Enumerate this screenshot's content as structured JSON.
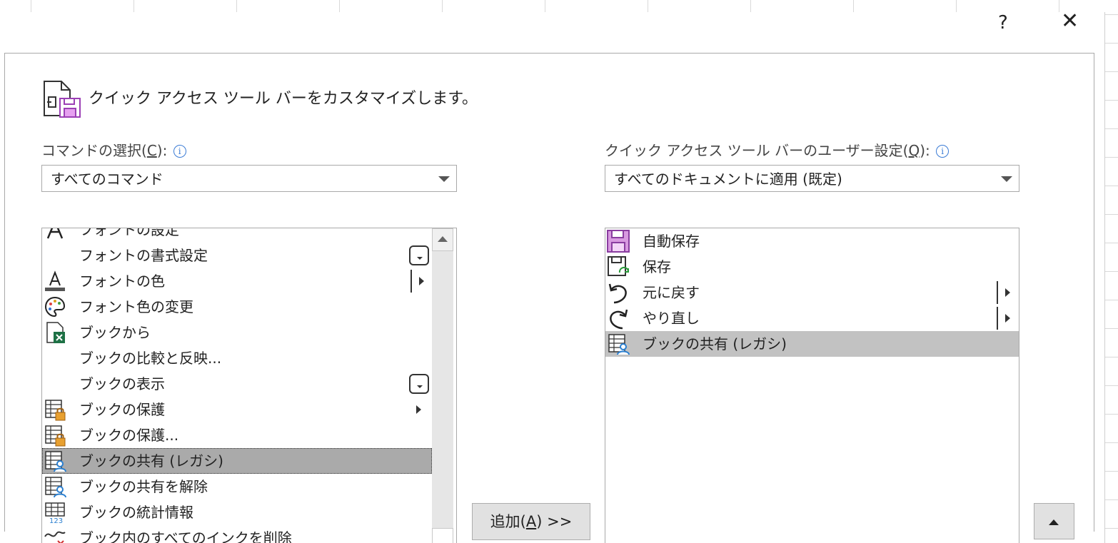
{
  "dialog": {
    "help_label": "?",
    "close_label": "✕",
    "header_text": "クイック アクセス ツール バーをカスタマイズします。"
  },
  "left": {
    "label_prefix": "コマンドの選択(",
    "label_key": "C",
    "label_suffix": "):",
    "combo_value": "すべてのコマンド",
    "items": [
      {
        "label": "フォントの設定",
        "icon": "font-a-icon"
      },
      {
        "label": "フォントの書式設定",
        "icon": ""
      },
      {
        "label": "フォントの色",
        "icon": "font-color-icon"
      },
      {
        "label": "フォント色の変更",
        "icon": "palette-icon"
      },
      {
        "label": "ブックから",
        "icon": "excel-file-icon"
      },
      {
        "label": "ブックの比較と反映...",
        "icon": ""
      },
      {
        "label": "ブックの表示",
        "icon": ""
      },
      {
        "label": "ブックの保護",
        "icon": "workbook-lock-icon"
      },
      {
        "label": "ブックの保護...",
        "icon": "workbook-lock-icon"
      },
      {
        "label": "ブックの共有 (レガシ)",
        "icon": "workbook-share-icon"
      },
      {
        "label": "ブックの共有を解除",
        "icon": "workbook-share-icon"
      },
      {
        "label": "ブックの統計情報",
        "icon": "workbook-stats-icon"
      },
      {
        "label": "ブック内のすべてのインクを削除",
        "icon": "ink-delete-icon"
      }
    ]
  },
  "right": {
    "label_prefix": "クイック アクセス ツール バーのユーザー設定(",
    "label_key": "Q",
    "label_suffix": "):",
    "combo_value": "すべてのドキュメントに適用 (既定)",
    "items": [
      {
        "label": "自動保存",
        "icon": "autosave-icon"
      },
      {
        "label": "保存",
        "icon": "save-icon"
      },
      {
        "label": "元に戻す",
        "icon": "undo-icon"
      },
      {
        "label": "やり直し",
        "icon": "redo-icon"
      },
      {
        "label": "ブックの共有 (レガシ)",
        "icon": "workbook-share-icon"
      }
    ]
  },
  "add_button": {
    "prefix": "追加(",
    "key": "A",
    "suffix": ") >>"
  }
}
